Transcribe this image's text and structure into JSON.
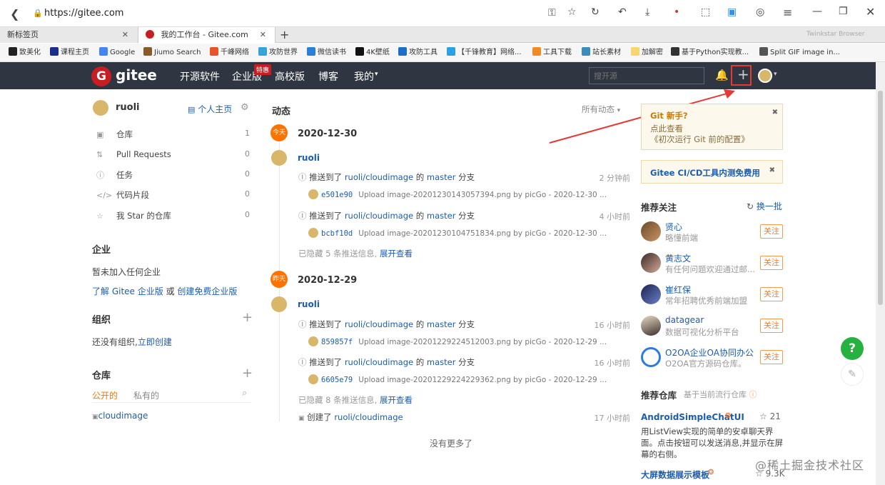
{
  "browser": {
    "url": "https://gitee.com",
    "tabs": [
      {
        "label": "新标签页"
      },
      {
        "label": "我的工作台 - Gitee.com"
      }
    ],
    "tab_right_text": "Twinkstar Browser",
    "bookmarks": [
      "致美化",
      "课程主页",
      "Google",
      "Jiumo Search",
      "千峰网络",
      "攻防世界",
      "微信读书",
      "4K壁纸",
      "攻防工具",
      "【千锋教育】网络...",
      "工具下载",
      "站长素材",
      "加解密",
      "基于Python实现教...",
      "Split GIF image in..."
    ]
  },
  "nav": {
    "logo": "gitee",
    "links": [
      "开源软件",
      "企业版",
      "高校版",
      "博客",
      "我的"
    ],
    "badge": "特惠",
    "search_placeholder": "搜开源"
  },
  "sidebar": {
    "username": "ruoli",
    "homepage": "个人主页",
    "items": [
      {
        "label": "仓库",
        "count": "1"
      },
      {
        "label": "Pull Requests",
        "count": "0"
      },
      {
        "label": "任务",
        "count": "0"
      },
      {
        "label": "代码片段",
        "count": "0"
      },
      {
        "label": "我 Star 的仓库",
        "count": "0"
      }
    ],
    "enterprise_title": "企业",
    "enterprise_empty": "暂未加入任何企业",
    "enterprise_link1": "了解 Gitee 企业版",
    "enterprise_or": "或",
    "enterprise_link2": "创建免费企业版",
    "org_title": "组织",
    "org_empty": "还没有组织,",
    "org_create": "立即创建",
    "repo_title": "仓库",
    "repo_tab_public": "公开的",
    "repo_tab_private": "私有的",
    "repo_item": "cloudimage"
  },
  "feed": {
    "title": "动态",
    "filter": "所有动态",
    "today_badge": "今天",
    "yesterday_badge": "昨天",
    "date1": "2020-12-30",
    "date2": "2020-12-29",
    "user": "ruoli",
    "push_prefix": "推送到了",
    "repo": "ruoli/cloudimage",
    "of": "的",
    "branch": "master",
    "branch_suffix": "分支",
    "events": [
      {
        "time": "2 分钟前",
        "sha": "e501e90",
        "msg": "Upload image-20201230143057394.png by picGo - 2020-12-30 ..."
      },
      {
        "time": "4 小时前",
        "sha": "bcbf10d",
        "msg": "Upload image-20201230104751834.png by picGo - 2020-12-30 ..."
      },
      {
        "time": "16 小时前",
        "sha": "859857f",
        "msg": "Upload image-20201229224512003.png by picGo - 2020-12-29 ..."
      },
      {
        "time": "16 小时前",
        "sha": "6605e79",
        "msg": "Upload image-20201229224229362.png by picGo - 2020-12-29 ..."
      }
    ],
    "hidden1": "已隐藏 5 条推送信息,",
    "hidden2": "已隐藏 8 条推送信息,",
    "expand": "展开查看",
    "create_prefix": "创建了",
    "create_time": "17 小时前",
    "no_more": "没有更多了"
  },
  "right": {
    "tip_title": "Git 新手?",
    "tip_text_prefix": "点此查看",
    "tip_link": "《初次运行 Git 前的配置》",
    "cicd": "Gitee CI/CD工具内测免费用",
    "recommend_title": "推荐关注",
    "refresh": "换一批",
    "follow_label": "关注",
    "users": [
      {
        "name": "贤心",
        "desc": "略懂前端"
      },
      {
        "name": "黄志文",
        "desc": "有任何问题欢迎通过邮..."
      },
      {
        "name": "崔红保",
        "desc": "常年招聘优秀前端加盟"
      },
      {
        "name": "datagear",
        "desc": "数据可视化分析平台"
      },
      {
        "name": "O2OA企业OA协同办公",
        "desc": "O2OA官方源码仓库。"
      }
    ],
    "repos_title": "推荐仓库",
    "repos_sub": "基于当前流行仓库",
    "repo1_name": "AndroidSimpleChatUI",
    "repo1_stars": "21",
    "repo1_desc": "用ListView实现的简单的安卓聊天界面。点击按钮可以发送消息,并显示在屏幕的右侧。",
    "repo2_name": "大屏数据展示模板",
    "repo2_stars": "9.3K"
  },
  "watermark": "@稀土掘金技术社区",
  "colors": {
    "nav_bg": "#2f3641",
    "accent": "#fe7300",
    "link": "#1c5dad",
    "annotation": "#e53935",
    "help": "#27b140"
  }
}
